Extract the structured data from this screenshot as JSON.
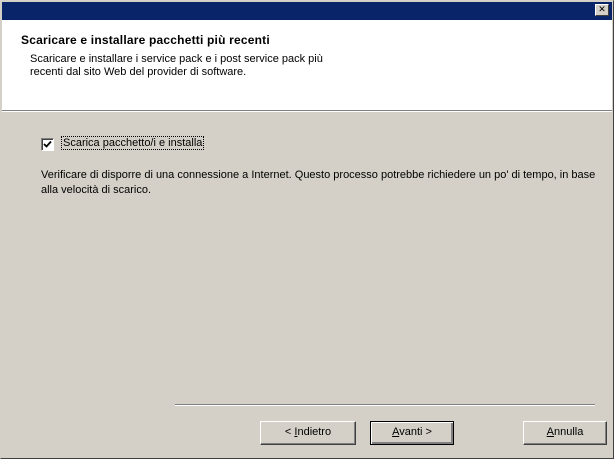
{
  "window": {
    "close_glyph": "✕"
  },
  "header": {
    "title": "Scaricare e installare pacchetti più recenti",
    "subtitle": "Scaricare e installare i service pack e i post service pack più recenti dal sito Web del provider di software."
  },
  "options": {
    "download_checkbox": {
      "label": "Scarica pacchetto/i e installa",
      "checked": true
    }
  },
  "info_text": "Verificare di disporre di una connessione a Internet. Questo processo potrebbe richiedere un po' di tempo, in base alla velocità di scarico.",
  "buttons": {
    "back": {
      "prefix": "< ",
      "mnemonic": "I",
      "rest": "ndietro"
    },
    "next": {
      "mnemonic": "A",
      "rest": "vanti >"
    },
    "cancel": {
      "mnemonic": "A",
      "rest": "nnulla"
    }
  },
  "colors": {
    "titlebar": "#0a246a",
    "face": "#d4d0c8",
    "header_bg": "#ffffff"
  }
}
